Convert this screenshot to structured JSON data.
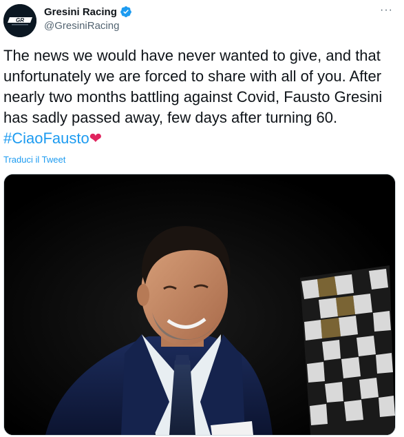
{
  "account": {
    "display_name": "Gresini Racing",
    "handle": "@GresiniRacing",
    "avatar_text": "GR",
    "verified": true
  },
  "menu": {
    "more_label": "···"
  },
  "tweet": {
    "line1": "The news we would have never wanted to give, and that",
    "line2": "unfortunately we are forced to share with all of you. After",
    "line3": "nearly two months battling against Covid, Fausto Gresini",
    "line4": "has sadly passed away, few days after turning 60.",
    "hashtag": "#CiaoFausto",
    "emoji": "❤"
  },
  "translate_link": "Traduci il Tweet",
  "colors": {
    "link": "#1d9bf0",
    "text": "#0f1419",
    "muted": "#536471",
    "verified": "#1d9bf0",
    "heart": "#e0245e"
  },
  "icons": [
    "verified-badge-icon",
    "more-options-icon",
    "heart-emoji-icon"
  ]
}
